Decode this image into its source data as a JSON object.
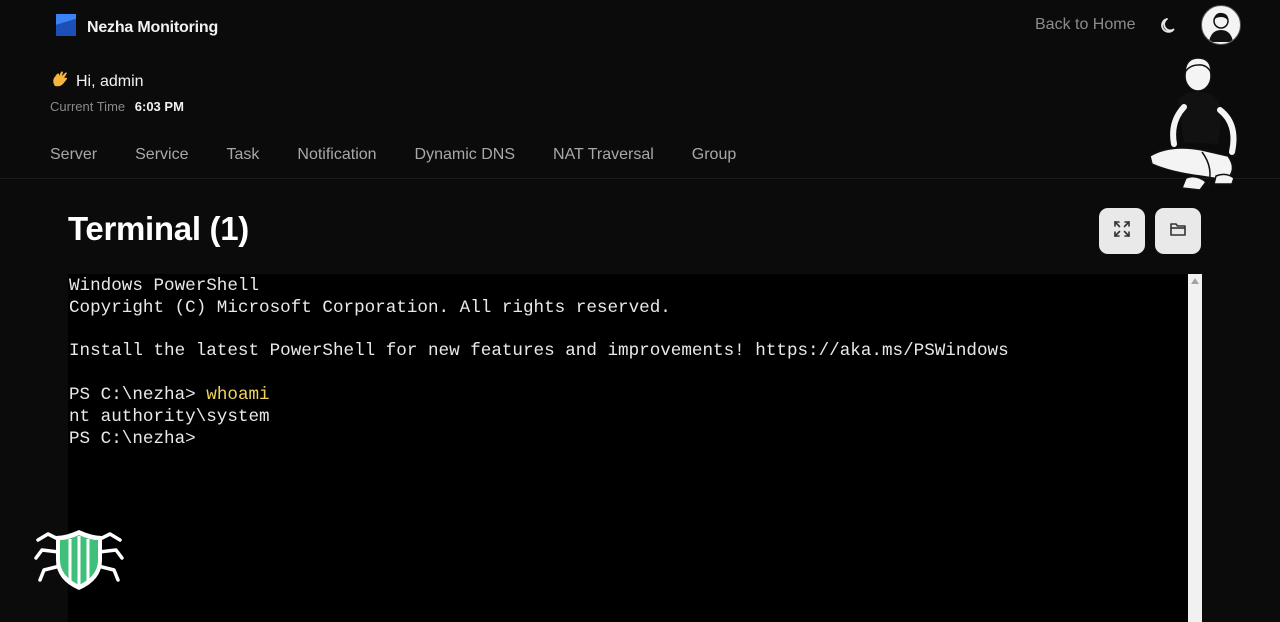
{
  "app": {
    "name": "Nezha Monitoring",
    "back_to_home": "Back to Home"
  },
  "greeting": {
    "text": "Hi, admin",
    "time_label": "Current Time",
    "time_value": "6:03 PM"
  },
  "nav": {
    "items": [
      "Server",
      "Service",
      "Task",
      "Notification",
      "Dynamic DNS",
      "NAT Traversal",
      "Group"
    ]
  },
  "page": {
    "title": "Terminal (1)"
  },
  "toolbar": {
    "fullscreen_icon": "fullscreen-icon",
    "files_icon": "folder-icon"
  },
  "terminal": {
    "line1": "Windows PowerShell",
    "line2": "Copyright (C) Microsoft Corporation. All rights reserved.",
    "line3": "",
    "line4": "Install the latest PowerShell for new features and improvements! https://aka.ms/PSWindows",
    "line5": "",
    "prompt1": "PS C:\\nezha> ",
    "command1": "whoami",
    "output1": "nt authority\\system",
    "prompt2": "PS C:\\nezha>"
  },
  "colors": {
    "background": "#0b0b0c",
    "terminal_bg": "#000000",
    "command_color": "#f0d35a",
    "brand_blue": "#2d6cdf",
    "watermark_green": "#3fbf7a"
  }
}
